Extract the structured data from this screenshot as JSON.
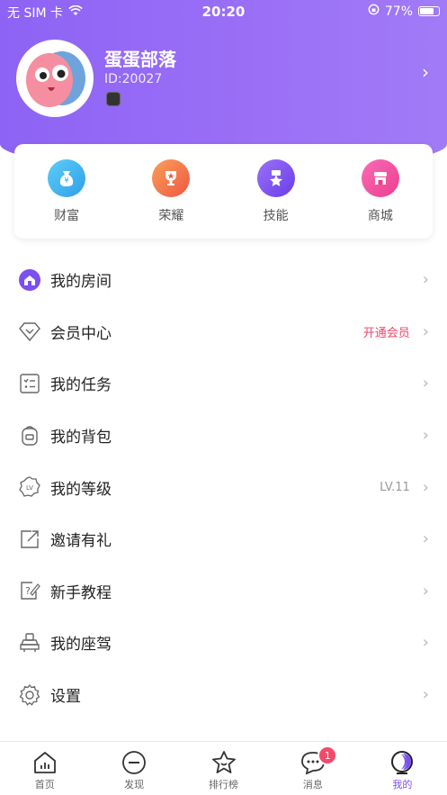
{
  "status_bar": {
    "carrier": "无 SIM 卡",
    "time": "20:20",
    "battery": "77%"
  },
  "profile": {
    "nickname": "蛋蛋部落",
    "user_id": "ID:20027"
  },
  "quick_actions": [
    {
      "label": "财富",
      "icon": "money-bag-icon",
      "color": "#34b3f0"
    },
    {
      "label": "荣耀",
      "icon": "trophy-icon",
      "color": "#f26d4f"
    },
    {
      "label": "技能",
      "icon": "skill-star-icon",
      "color": "#7a4ff0"
    },
    {
      "label": "商城",
      "icon": "shop-icon",
      "color": "#f2479a"
    }
  ],
  "menu": [
    {
      "label": "我的房间",
      "icon": "room-icon",
      "extra": ""
    },
    {
      "label": "会员中心",
      "icon": "diamond-icon",
      "extra": "开通会员",
      "extra_color": "#f0446b"
    },
    {
      "label": "我的任务",
      "icon": "task-icon",
      "extra": ""
    },
    {
      "label": "我的背包",
      "icon": "backpack-icon",
      "extra": ""
    },
    {
      "label": "我的等级",
      "icon": "level-icon",
      "extra": "LV.11",
      "extra_color": "#999999"
    },
    {
      "label": "邀请有礼",
      "icon": "invite-icon",
      "extra": ""
    },
    {
      "label": "新手教程",
      "icon": "tutorial-icon",
      "extra": ""
    },
    {
      "label": "我的座驾",
      "icon": "vehicle-icon",
      "extra": ""
    },
    {
      "label": "设置",
      "icon": "settings-gear-icon",
      "extra": ""
    }
  ],
  "tabbar": [
    {
      "label": "首页",
      "icon": "home-icon"
    },
    {
      "label": "发现",
      "icon": "discover-icon"
    },
    {
      "label": "排行榜",
      "icon": "ranking-star-icon"
    },
    {
      "label": "消息",
      "icon": "message-icon",
      "badge": "1"
    },
    {
      "label": "我的",
      "icon": "profile-icon",
      "active": true
    }
  ],
  "colors": {
    "accent": "#7b4ff0",
    "header_gradient_start": "#8d63f5",
    "header_gradient_end": "#a07bf7"
  }
}
